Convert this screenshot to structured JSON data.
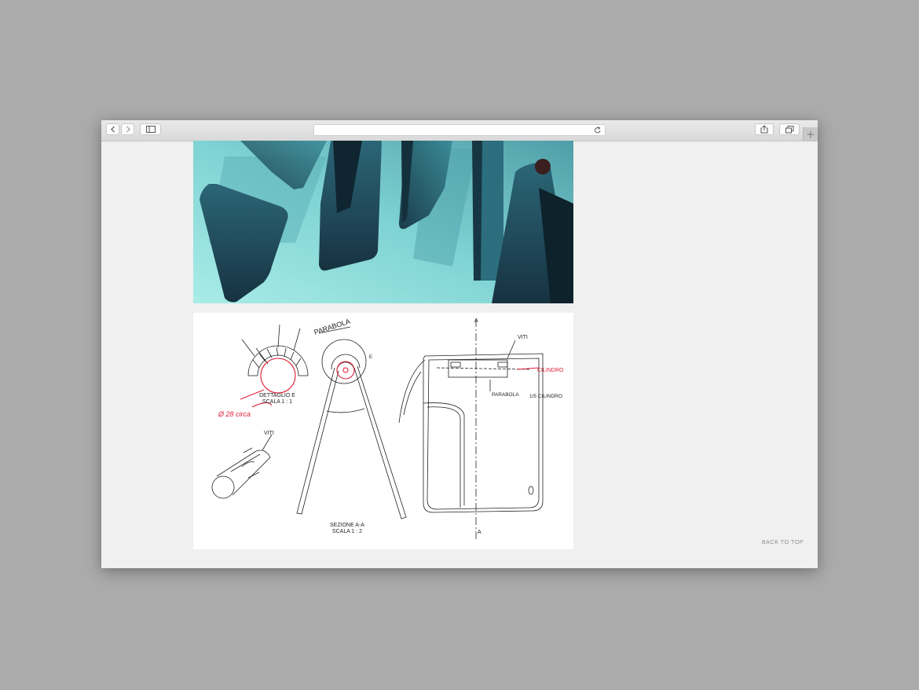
{
  "browser": {
    "toolbar": {
      "back_icon": "chevron-left-icon",
      "forward_icon": "chevron-right-icon",
      "sidebar_icon": "sidebar-icon",
      "reload_icon": "reload-icon",
      "share_icon": "share-icon",
      "tabs_icon": "tabs-overview-icon",
      "new_tab_icon": "plus-icon"
    },
    "address_bar": {
      "value": ""
    }
  },
  "page": {
    "photo": {
      "subject": "teal folded metal panels"
    },
    "drawing": {
      "labels": {
        "parabola": "PARABOLA",
        "detail_title": "DETTAGLIO E",
        "detail_scale": "SCALA 1 : 1",
        "section_title": "SEZIONE A-A",
        "section_scale": "SCALA 1 : 2",
        "screws_left": "VITI",
        "screws_right": "VITI",
        "cylinder": "CILINDRO",
        "parabola_right": "PARABOLA",
        "fraction_cylinder": "1/5 CILINDRO",
        "diameter": "Ø 28 circa",
        "section_mark_top": "A",
        "section_mark_bottom": "A",
        "detail_mark": "E"
      }
    },
    "back_to_top": "BACK TO TOP"
  },
  "colors": {
    "page_bg": "#f0f0f0",
    "desktop_bg": "#ababab",
    "teal_light": "#bff0ee",
    "teal_dark": "#1c3d4c",
    "sketch_red": "#e0203a"
  }
}
